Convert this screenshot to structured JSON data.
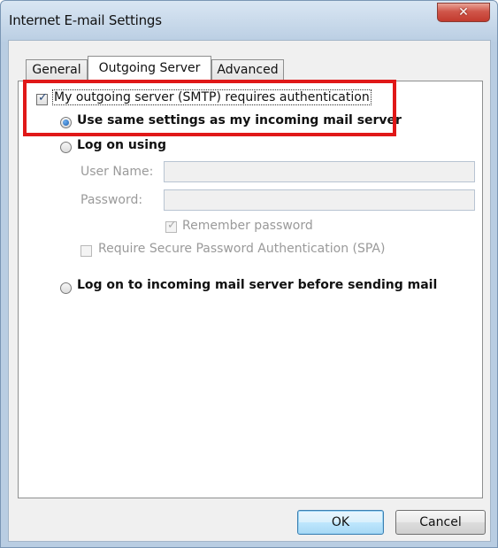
{
  "window": {
    "title": "Internet E-mail Settings",
    "close_glyph": "✕"
  },
  "tabs": [
    {
      "label": "General",
      "active": false
    },
    {
      "label": "Outgoing Server",
      "active": true
    },
    {
      "label": "Advanced",
      "active": false
    }
  ],
  "outgoing": {
    "requires_auth": {
      "label": "My outgoing server (SMTP) requires authentication",
      "checked": true
    },
    "use_same": {
      "label": "Use same settings as my incoming mail server",
      "selected": true
    },
    "log_on_using": {
      "label": "Log on using",
      "selected": false
    },
    "user_name": {
      "label": "User Name:",
      "value": ""
    },
    "password": {
      "label": "Password:",
      "value": ""
    },
    "remember_password": {
      "label": "Remember password",
      "checked": true
    },
    "require_spa": {
      "label": "Require Secure Password Authentication (SPA)",
      "checked": false
    },
    "log_on_incoming": {
      "label": "Log on to incoming mail server before sending mail",
      "selected": false
    }
  },
  "buttons": {
    "ok": "OK",
    "cancel": "Cancel"
  },
  "colors": {
    "highlight": "#e01818",
    "title_bar": "#b9cde2",
    "close_button": "#c23a2e",
    "default_button": "#bee6fd"
  },
  "icons": {
    "close": "close-icon",
    "checkbox_check": "check-icon",
    "radio_dot": "radio-dot-icon"
  }
}
